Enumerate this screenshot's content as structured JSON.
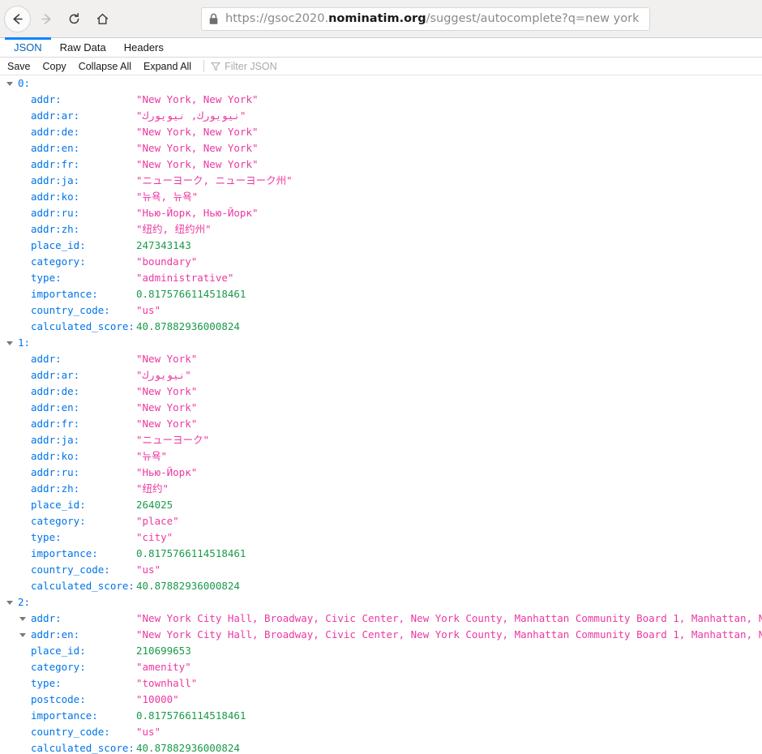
{
  "browser": {
    "nav": {
      "back_label": "Back",
      "forward_label": "Forward",
      "reload_label": "Reload",
      "home_label": "Home"
    },
    "urlbar": {
      "lock_icon": "padlock-icon",
      "url_prefix": "https://gsoc2020.",
      "url_host_strong": "nominatim.org",
      "url_suffix": "/suggest/autocomplete?q=new york",
      "full_url": "https://gsoc2020.nominatim.org/suggest/autocomplete?q=new york"
    }
  },
  "devtools": {
    "tabs": [
      {
        "label": "JSON",
        "active": true
      },
      {
        "label": "Raw Data",
        "active": false
      },
      {
        "label": "Headers",
        "active": false
      }
    ],
    "toolbar": {
      "save_label": "Save",
      "copy_label": "Copy",
      "collapse_all_label": "Collapse All",
      "expand_all_label": "Expand All",
      "filter_icon": "filter-funnel-icon",
      "filter_placeholder": "Filter JSON"
    }
  },
  "json": {
    "entries": [
      {
        "index": "0:",
        "expanded": true,
        "fields": [
          {
            "key": "addr:",
            "value": "\"New York, New York\"",
            "type": "str",
            "rtl": false,
            "collapsible": false
          },
          {
            "key": "addr:ar:",
            "value": "\"نيويورك, نيويورك\"",
            "type": "str",
            "rtl": true,
            "collapsible": false
          },
          {
            "key": "addr:de:",
            "value": "\"New York, New York\"",
            "type": "str",
            "rtl": false,
            "collapsible": false
          },
          {
            "key": "addr:en:",
            "value": "\"New York, New York\"",
            "type": "str",
            "rtl": false,
            "collapsible": false
          },
          {
            "key": "addr:fr:",
            "value": "\"New York, New York\"",
            "type": "str",
            "rtl": false,
            "collapsible": false
          },
          {
            "key": "addr:ja:",
            "value": "\"ニューヨーク, ニューヨーク州\"",
            "type": "str",
            "rtl": false,
            "collapsible": false
          },
          {
            "key": "addr:ko:",
            "value": "\"뉴욕, 뉴욕\"",
            "type": "str",
            "rtl": false,
            "collapsible": false
          },
          {
            "key": "addr:ru:",
            "value": "\"Нью-Йорк, Нью-Йорк\"",
            "type": "str",
            "rtl": false,
            "collapsible": false
          },
          {
            "key": "addr:zh:",
            "value": "\"纽约, 纽约州\"",
            "type": "str",
            "rtl": false,
            "collapsible": false
          },
          {
            "key": "place_id:",
            "value": "247343143",
            "type": "num",
            "rtl": false,
            "collapsible": false
          },
          {
            "key": "category:",
            "value": "\"boundary\"",
            "type": "str",
            "rtl": false,
            "collapsible": false
          },
          {
            "key": "type:",
            "value": "\"administrative\"",
            "type": "str",
            "rtl": false,
            "collapsible": false
          },
          {
            "key": "importance:",
            "value": "0.8175766114518461",
            "type": "num",
            "rtl": false,
            "collapsible": false
          },
          {
            "key": "country_code:",
            "value": "\"us\"",
            "type": "str",
            "rtl": false,
            "collapsible": false
          },
          {
            "key": "calculated_score:",
            "value": "40.87882936000824",
            "type": "num",
            "rtl": false,
            "collapsible": false
          }
        ]
      },
      {
        "index": "1:",
        "expanded": true,
        "fields": [
          {
            "key": "addr:",
            "value": "\"New York\"",
            "type": "str",
            "rtl": false,
            "collapsible": false
          },
          {
            "key": "addr:ar:",
            "value": "\"نيويورك\"",
            "type": "str",
            "rtl": true,
            "collapsible": false
          },
          {
            "key": "addr:de:",
            "value": "\"New York\"",
            "type": "str",
            "rtl": false,
            "collapsible": false
          },
          {
            "key": "addr:en:",
            "value": "\"New York\"",
            "type": "str",
            "rtl": false,
            "collapsible": false
          },
          {
            "key": "addr:fr:",
            "value": "\"New York\"",
            "type": "str",
            "rtl": false,
            "collapsible": false
          },
          {
            "key": "addr:ja:",
            "value": "\"ニューヨーク\"",
            "type": "str",
            "rtl": false,
            "collapsible": false
          },
          {
            "key": "addr:ko:",
            "value": "\"뉴욕\"",
            "type": "str",
            "rtl": false,
            "collapsible": false
          },
          {
            "key": "addr:ru:",
            "value": "\"Нью-Йорк\"",
            "type": "str",
            "rtl": false,
            "collapsible": false
          },
          {
            "key": "addr:zh:",
            "value": "\"纽约\"",
            "type": "str",
            "rtl": false,
            "collapsible": false
          },
          {
            "key": "place_id:",
            "value": "264025",
            "type": "num",
            "rtl": false,
            "collapsible": false
          },
          {
            "key": "category:",
            "value": "\"place\"",
            "type": "str",
            "rtl": false,
            "collapsible": false
          },
          {
            "key": "type:",
            "value": "\"city\"",
            "type": "str",
            "rtl": false,
            "collapsible": false
          },
          {
            "key": "importance:",
            "value": "0.8175766114518461",
            "type": "num",
            "rtl": false,
            "collapsible": false
          },
          {
            "key": "country_code:",
            "value": "\"us\"",
            "type": "str",
            "rtl": false,
            "collapsible": false
          },
          {
            "key": "calculated_score:",
            "value": "40.87882936000824",
            "type": "num",
            "rtl": false,
            "collapsible": false
          }
        ]
      },
      {
        "index": "2:",
        "expanded": true,
        "fields": [
          {
            "key": "addr:",
            "value": "\"New York City Hall, Broadway, Civic Center, New York County, Manhattan Community Board 1, Manhattan, New York\"",
            "type": "str",
            "rtl": false,
            "collapsible": true
          },
          {
            "key": "addr:en:",
            "value": "\"New York City Hall, Broadway, Civic Center, New York County, Manhattan Community Board 1, Manhattan, New York\"",
            "type": "str",
            "rtl": false,
            "collapsible": true
          },
          {
            "key": "place_id:",
            "value": "210699653",
            "type": "num",
            "rtl": false,
            "collapsible": false
          },
          {
            "key": "category:",
            "value": "\"amenity\"",
            "type": "str",
            "rtl": false,
            "collapsible": false
          },
          {
            "key": "type:",
            "value": "\"townhall\"",
            "type": "str",
            "rtl": false,
            "collapsible": false
          },
          {
            "key": "postcode:",
            "value": "\"10000\"",
            "type": "str",
            "rtl": false,
            "collapsible": false
          },
          {
            "key": "importance:",
            "value": "0.8175766114518461",
            "type": "num",
            "rtl": false,
            "collapsible": false
          },
          {
            "key": "country_code:",
            "value": "\"us\"",
            "type": "str",
            "rtl": false,
            "collapsible": false
          },
          {
            "key": "calculated_score:",
            "value": "40.87882936000824",
            "type": "num",
            "rtl": false,
            "collapsible": false
          }
        ]
      }
    ]
  },
  "colors": {
    "key": "#0074e8",
    "string": "#ec38a0",
    "number": "#1a9a4a",
    "accent": "#0a84ff",
    "toolbar_bg": "#f1f0ef"
  }
}
